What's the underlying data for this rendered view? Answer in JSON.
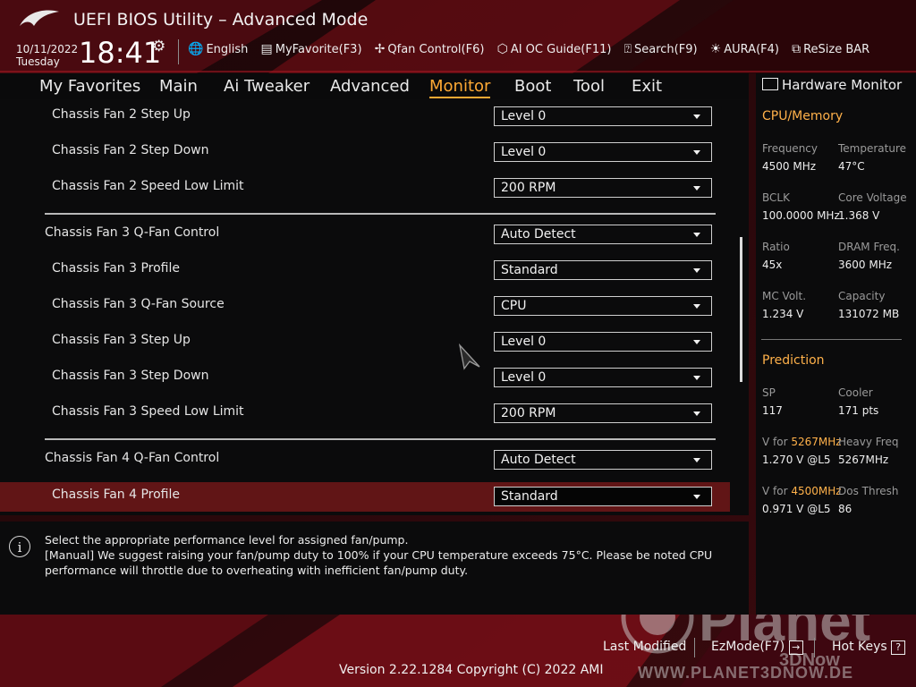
{
  "header": {
    "title": "UEFI BIOS Utility – Advanced Mode",
    "date": "10/11/2022",
    "day": "Tuesday",
    "time": "18:41",
    "tools": [
      {
        "label": "English",
        "icon": "globe-icon"
      },
      {
        "label": "MyFavorite(F3)",
        "icon": "favorite-icon"
      },
      {
        "label": "Qfan Control(F6)",
        "icon": "fan-icon"
      },
      {
        "label": "AI OC Guide(F11)",
        "icon": "ai-guide-icon"
      },
      {
        "label": "Search(F9)",
        "icon": "search-icon"
      },
      {
        "label": "AURA(F4)",
        "icon": "aura-icon"
      },
      {
        "label": "ReSize BAR",
        "icon": "resize-bar-icon"
      }
    ]
  },
  "menu": {
    "tabs": [
      "My Favorites",
      "Main",
      "Ai Tweaker",
      "Advanced",
      "Monitor",
      "Boot",
      "Tool",
      "Exit"
    ],
    "active": "Monitor"
  },
  "settings": {
    "rows": [
      {
        "label": "Chassis Fan 2 Step Up",
        "value": "Level 0"
      },
      {
        "label": "Chassis Fan 2 Step Down",
        "value": "Level 0"
      },
      {
        "label": "Chassis Fan 2 Speed Low Limit",
        "value": "200 RPM"
      },
      {
        "label": "Chassis Fan 3 Q-Fan Control",
        "value": "Auto Detect"
      },
      {
        "label": "Chassis Fan 3 Profile",
        "value": "Standard"
      },
      {
        "label": "Chassis Fan 3 Q-Fan Source",
        "value": "CPU"
      },
      {
        "label": "Chassis Fan 3 Step Up",
        "value": "Level 0"
      },
      {
        "label": "Chassis Fan 3 Step Down",
        "value": "Level 0"
      },
      {
        "label": "Chassis Fan 3 Speed Low Limit",
        "value": "200 RPM"
      },
      {
        "label": "Chassis Fan 4 Q-Fan Control",
        "value": "Auto Detect"
      },
      {
        "label": "Chassis Fan 4 Profile",
        "value": "Standard"
      }
    ],
    "selected_row": "Chassis Fan 4 Profile"
  },
  "help": {
    "lines": [
      "Select the appropriate performance level for assigned fan/pump.",
      "[Manual] We suggest raising your fan/pump duty to 100% if your CPU temperature exceeds 75°C. Please be noted CPU performance will throttle due to overheating with inefficient fan/pump duty."
    ]
  },
  "hardware_monitor": {
    "title": "Hardware Monitor",
    "cpu_memory": {
      "heading": "CPU/Memory",
      "items": [
        {
          "key": "Frequency",
          "value": "4500 MHz"
        },
        {
          "key": "Temperature",
          "value": "47°C"
        },
        {
          "key": "BCLK",
          "value": "100.0000 MHz"
        },
        {
          "key": "Core Voltage",
          "value": "1.368 V"
        },
        {
          "key": "Ratio",
          "value": "45x"
        },
        {
          "key": "DRAM Freq.",
          "value": "3600 MHz"
        },
        {
          "key": "MC Volt.",
          "value": "1.234 V"
        },
        {
          "key": "Capacity",
          "value": "131072 MB"
        }
      ]
    },
    "prediction": {
      "heading": "Prediction",
      "sp_key": "SP",
      "sp_value": "117",
      "cooler_key": "Cooler",
      "cooler_value": "171 pts",
      "v_for_prefix": "V for",
      "v1_freq": "5267MHz",
      "v1_value": "1.270 V @L5",
      "heavy_freq_key": "Heavy Freq",
      "heavy_freq_value": "5267MHz",
      "v2_freq": "4500MHz",
      "v2_value": "0.971 V @L5",
      "dos_thresh_key": "Dos Thresh",
      "dos_thresh_value": "86"
    }
  },
  "footer": {
    "last_modified": "Last Modified",
    "ezmode": "EzMode(F7)",
    "hotkeys": "Hot Keys",
    "hotkeys_key": "?",
    "version": "Version 2.22.1284 Copyright (C) 2022 AMI"
  },
  "watermark": {
    "text": "Planet",
    "sub": "3DNow",
    "url": "WWW.PLANET3DNOW.DE"
  },
  "colors": {
    "accent": "#ffa934",
    "highlight_row": "#611516",
    "brand_red": "#8a0f14"
  }
}
